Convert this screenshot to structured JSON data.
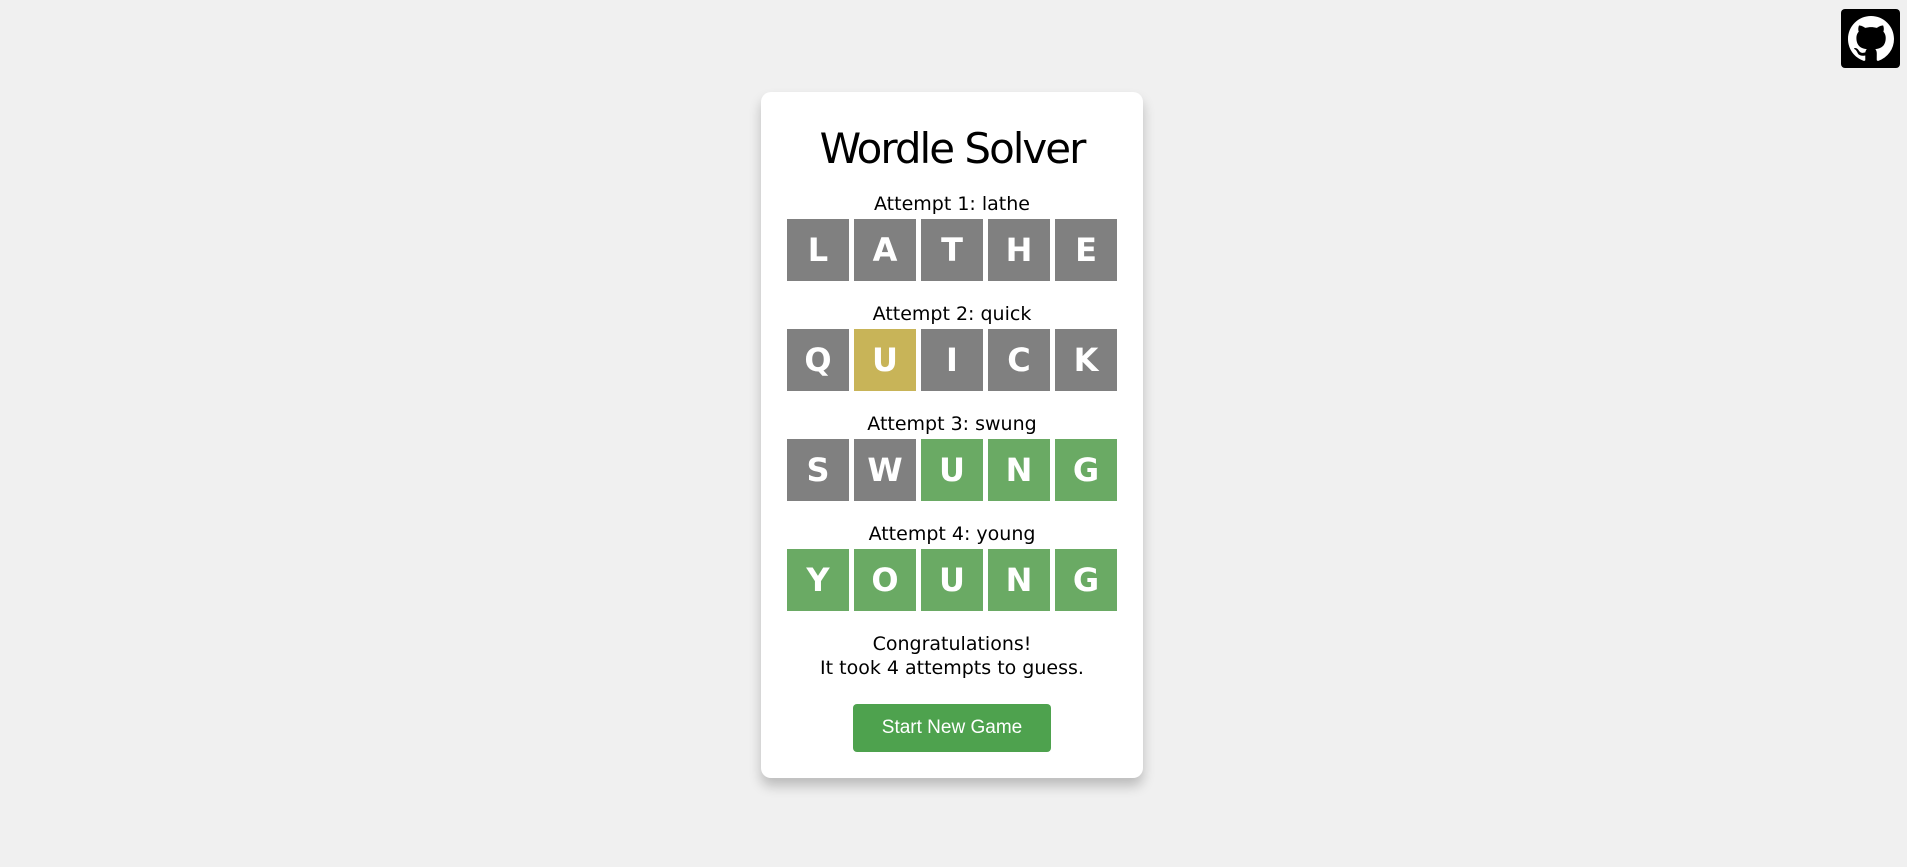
{
  "github": {
    "icon": "github-icon",
    "color": "#000000"
  },
  "app": {
    "title": "Wordle Solver"
  },
  "attempts": [
    {
      "label": "Attempt 1: lathe",
      "tiles": [
        {
          "letter": "L",
          "state": "absent"
        },
        {
          "letter": "A",
          "state": "absent"
        },
        {
          "letter": "T",
          "state": "absent"
        },
        {
          "letter": "H",
          "state": "absent"
        },
        {
          "letter": "E",
          "state": "absent"
        }
      ]
    },
    {
      "label": "Attempt 2: quick",
      "tiles": [
        {
          "letter": "Q",
          "state": "absent"
        },
        {
          "letter": "U",
          "state": "present"
        },
        {
          "letter": "I",
          "state": "absent"
        },
        {
          "letter": "C",
          "state": "absent"
        },
        {
          "letter": "K",
          "state": "absent"
        }
      ]
    },
    {
      "label": "Attempt 3: swung",
      "tiles": [
        {
          "letter": "S",
          "state": "absent"
        },
        {
          "letter": "W",
          "state": "absent"
        },
        {
          "letter": "U",
          "state": "correct"
        },
        {
          "letter": "N",
          "state": "correct"
        },
        {
          "letter": "G",
          "state": "correct"
        }
      ]
    },
    {
      "label": "Attempt 4: young",
      "tiles": [
        {
          "letter": "Y",
          "state": "correct"
        },
        {
          "letter": "O",
          "state": "correct"
        },
        {
          "letter": "U",
          "state": "correct"
        },
        {
          "letter": "N",
          "state": "correct"
        },
        {
          "letter": "G",
          "state": "correct"
        }
      ]
    }
  ],
  "result": {
    "line1": "Congratulations!",
    "line2": "It took 4 attempts to guess."
  },
  "button": {
    "label": "Start New Game"
  },
  "colors": {
    "absent": "#808080",
    "present": "#c8b458",
    "correct": "#6aaa64",
    "button": "#4ea24e",
    "background": "#f0f0f0"
  }
}
